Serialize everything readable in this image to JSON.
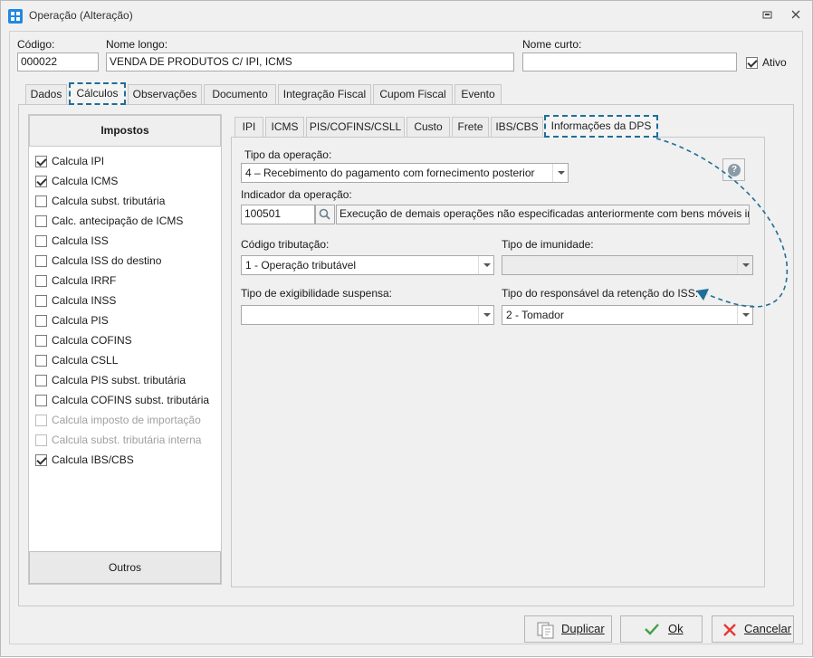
{
  "window": {
    "title": "Operação (Alteração)"
  },
  "header": {
    "codigo_label": "Código:",
    "codigo_value": "000022",
    "nome_longo_label": "Nome longo:",
    "nome_longo_value": "VENDA DE PRODUTOS C/ IPI, ICMS",
    "nome_curto_label": "Nome curto:",
    "nome_curto_value": "",
    "ativo_label": "Ativo"
  },
  "main_tabs": [
    "Dados",
    "Cálculos",
    "Observações",
    "Documento",
    "Integração Fiscal",
    "Cupom Fiscal",
    "Evento"
  ],
  "impostos": {
    "title": "Impostos",
    "items": [
      {
        "label": "Calcula IPI",
        "checked": true,
        "disabled": false
      },
      {
        "label": "Calcula ICMS",
        "checked": true,
        "disabled": false
      },
      {
        "label": "Calcula subst. tributária",
        "checked": false,
        "disabled": false
      },
      {
        "label": "Calc. antecipação de ICMS",
        "checked": false,
        "disabled": false
      },
      {
        "label": "Calcula ISS",
        "checked": false,
        "disabled": false
      },
      {
        "label": "Calcula ISS do destino",
        "checked": false,
        "disabled": false
      },
      {
        "label": "Calcula IRRF",
        "checked": false,
        "disabled": false
      },
      {
        "label": "Calcula INSS",
        "checked": false,
        "disabled": false
      },
      {
        "label": "Calcula PIS",
        "checked": false,
        "disabled": false
      },
      {
        "label": "Calcula COFINS",
        "checked": false,
        "disabled": false
      },
      {
        "label": "Calcula CSLL",
        "checked": false,
        "disabled": false
      },
      {
        "label": "Calcula PIS subst. tributária",
        "checked": false,
        "disabled": false
      },
      {
        "label": "Calcula COFINS subst. tributária",
        "checked": false,
        "disabled": false
      },
      {
        "label": "Calcula imposto de importação",
        "checked": false,
        "disabled": true
      },
      {
        "label": "Calcula subst. tributária interna",
        "checked": false,
        "disabled": true
      },
      {
        "label": "Calcula IBS/CBS",
        "checked": true,
        "disabled": false
      }
    ],
    "outros_label": "Outros"
  },
  "sub_tabs": [
    "IPI",
    "ICMS",
    "PIS/COFINS/CSLL",
    "Custo",
    "Frete",
    "IBS/CBS",
    "Informações da DPS"
  ],
  "dps": {
    "tipo_operacao_label": "Tipo da operação:",
    "tipo_operacao_value": "4 – Recebimento do pagamento com fornecimento posterior",
    "indicador_label": "Indicador da operação:",
    "indicador_code": "100501",
    "indicador_desc": "Execução de demais operações não especificadas anteriormente com bens móveis ima",
    "codigo_tributacao_label": "Código tributação:",
    "codigo_tributacao_value": "1 - Operação tributável",
    "tipo_imunidade_label": "Tipo de imunidade:",
    "tipo_imunidade_value": "",
    "exigibilidade_label": "Tipo de exigibilidade suspensa:",
    "exigibilidade_value": "",
    "responsavel_label": "Tipo do responsável da retenção do ISS:",
    "responsavel_value": "2 - Tomador"
  },
  "footer": {
    "duplicar_label": "Duplicar",
    "ok_label": "Ok",
    "cancelar_label": "Cancelar"
  },
  "colors": {
    "highlight": "#1f6e98",
    "ok_check": "#43a047",
    "cancel_x": "#e53935"
  }
}
